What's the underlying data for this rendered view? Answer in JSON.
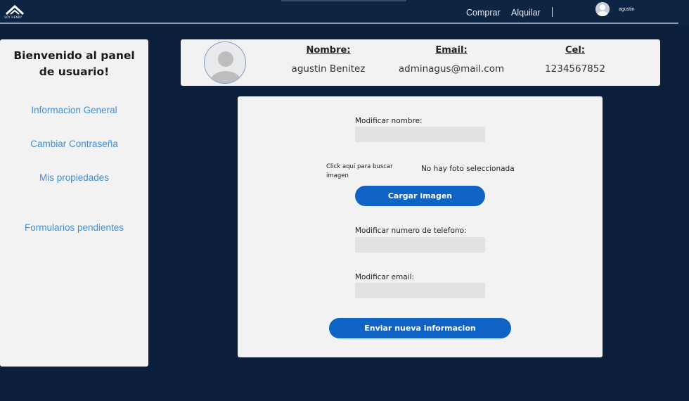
{
  "nav": {
    "logo_text": "SOY HENRY",
    "links": [
      "Comprar",
      "Alquilar"
    ],
    "username": "agustin"
  },
  "sidebar": {
    "title": "Bienvenido al panel de usuario!",
    "items": [
      {
        "label": "Informacion General"
      },
      {
        "label": "Cambiar Contraseña"
      },
      {
        "label": "Mis propiedades"
      },
      {
        "label": "Formularios pendientes"
      }
    ]
  },
  "profile": {
    "name_label": "Nombre:",
    "name_value": "agustin Benitez",
    "email_label": "Email:",
    "email_value": "adminagus@mail.com",
    "phone_label": "Cel:",
    "phone_value": "1234567852"
  },
  "form": {
    "name_label": "Modificar nombre:",
    "file_hint": "Click aqui para buscar imagen",
    "no_photo": "No hay foto seleccionada",
    "upload_button": "Cargar imagen",
    "phone_label": "Modificar numero de telefono:",
    "email_label": "Modificar email:",
    "submit_button": "Enviar nueva informacion"
  },
  "colors": {
    "background": "#0c1f3a",
    "accent": "#0e63c4",
    "link": "#3f8fd6"
  }
}
